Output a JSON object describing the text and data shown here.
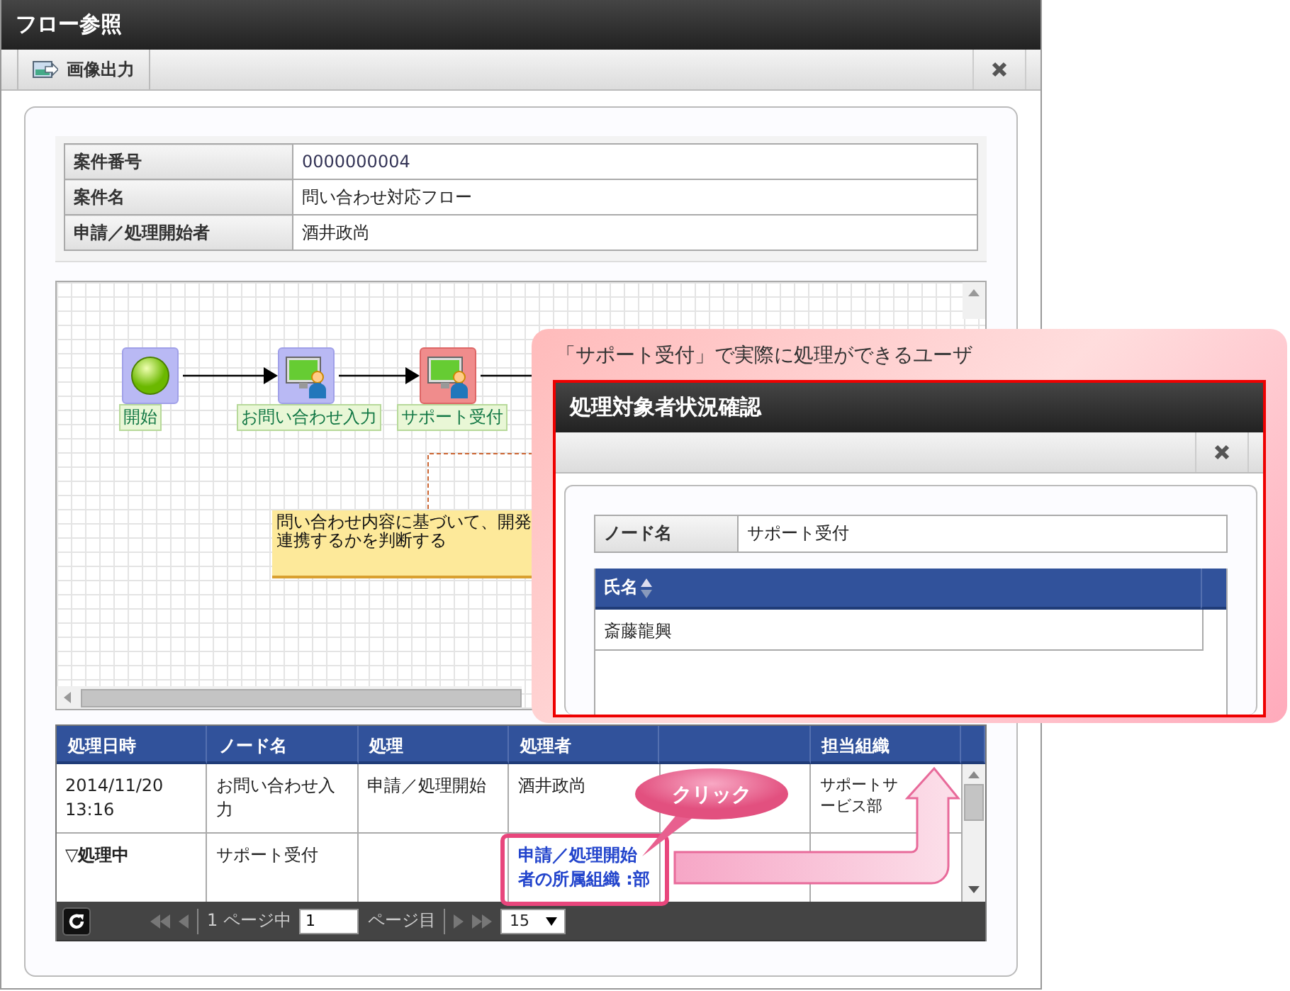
{
  "window": {
    "title": "フロー参照"
  },
  "toolbar": {
    "export_label": "画像出力"
  },
  "info": [
    {
      "label": "案件番号",
      "value": "0000000004",
      "kind": "number"
    },
    {
      "label": "案件名",
      "value": "問い合わせ対応フロー",
      "kind": "text"
    },
    {
      "label": "申請／処理開始者",
      "value": "酒井政尚",
      "kind": "text"
    }
  ],
  "diagram": {
    "nodes": [
      {
        "label": "開始",
        "kind": "start",
        "selected": false
      },
      {
        "label": "お問い合わせ入力",
        "kind": "task",
        "selected": false
      },
      {
        "label": "サポート受付",
        "kind": "task",
        "selected": true
      }
    ],
    "note": {
      "lines": [
        "問い合わせ内容に基づいて、開発",
        "連携するかを判断する"
      ]
    }
  },
  "history": {
    "columns": [
      "処理日時",
      "ノード名",
      "処理",
      "処理者",
      null,
      "担当組織"
    ],
    "rows": [
      {
        "kind": "done",
        "date": "2014/11/20 13:16",
        "node": "お問い合わせ入力",
        "action": "申請／処理開始",
        "operator": "酒井政尚",
        "organization": "サポートサービス部"
      },
      {
        "kind": "in_progress",
        "date": "▽処理中",
        "node": "サポート受付",
        "operator_link": "申請／処理開始者の所属組織 :部"
      }
    ],
    "pager": {
      "of_pages": "1 ページ中",
      "page": "1",
      "page_suffix": "ページ目",
      "page_size": "15"
    }
  },
  "callout": {
    "caption": "「サポート受付」で実際に処理ができるユーザ",
    "dialog": {
      "title": "処理対象者状況確認",
      "node_label": "ノード名",
      "node_value": "サポート受付",
      "column": "氏名",
      "users": [
        "斎藤龍興"
      ]
    }
  },
  "click_bubble": {
    "label": "クリック"
  }
}
